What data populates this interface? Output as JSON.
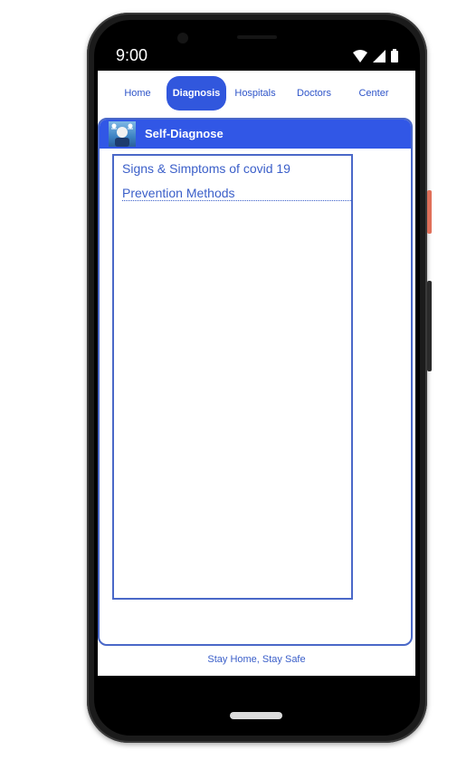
{
  "status": {
    "time": "9:00",
    "icons": [
      "wifi-icon",
      "cellular-signal-icon",
      "battery-icon"
    ]
  },
  "nav": {
    "tabs": [
      {
        "label": "Home",
        "active": false
      },
      {
        "label": "Diagnosis",
        "active": true
      },
      {
        "label": "Hospitals",
        "active": false
      },
      {
        "label": "Doctors",
        "active": false
      },
      {
        "label": "Center",
        "active": false
      }
    ]
  },
  "card": {
    "title": "Self-Diagnose",
    "image_icon": "doctor-illustration-icon",
    "items": [
      {
        "label": "Signs & Simptoms of covid 19"
      },
      {
        "label": "Prevention Methods"
      }
    ]
  },
  "footer": {
    "text": "Stay Home, Stay Safe"
  },
  "colors": {
    "accent": "#3157E6",
    "text_accent": "#3B5FC9",
    "border": "#4A68C8",
    "device": "#1B1B1B"
  }
}
